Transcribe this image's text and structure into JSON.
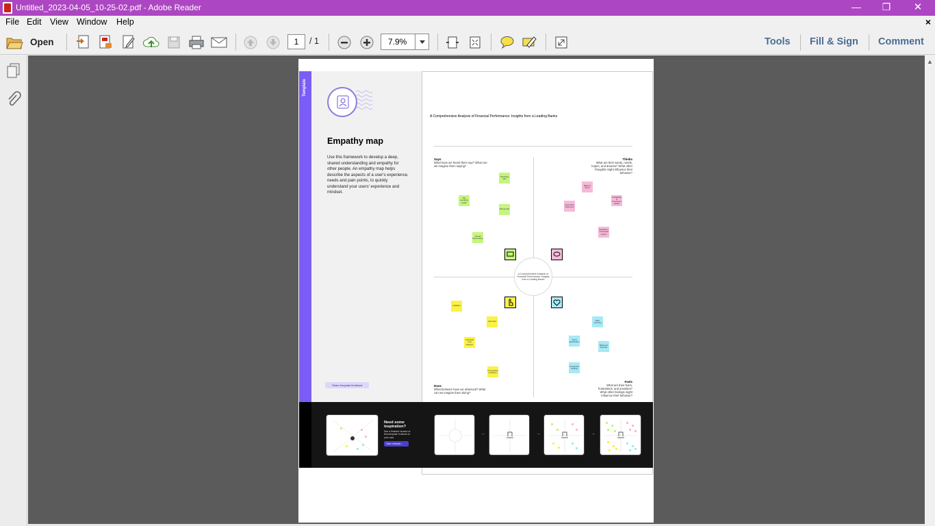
{
  "window": {
    "title": "Untitled_2023-04-05_10-25-02.pdf - Adobe Reader",
    "controls": {
      "minimize": "—",
      "restore": "❐",
      "close": "✕"
    }
  },
  "menu": {
    "items": [
      "File",
      "Edit",
      "View",
      "Window",
      "Help"
    ],
    "close": "×"
  },
  "toolbar": {
    "open_label": "Open",
    "page_current": "1",
    "page_total": "/ 1",
    "zoom": "7.9%",
    "tools": "Tools",
    "fill_sign": "Fill & Sign",
    "comment": "Comment"
  },
  "doc": {
    "side_label": "Template",
    "heading": "Empathy map",
    "description": "Use this framework to develop a deep, shared understanding and empathy for other people. An empathy map helps describe the aspects of a user's experience, needs and pain points, to quickly understand your users' experience and mindset.",
    "feedback": "Share template feedback",
    "board_title": "A Comprehensive Analysis of Financial Performance: Insights from a Leading Banks",
    "center_text": "A Comprehensive Analysis of Financial Performance: Insights from a Leading Banks",
    "quadrants": {
      "says": {
        "title": "Says",
        "lines": "What have we heard them say? What can we imagine them saying?"
      },
      "thinks": {
        "title": "Thinks",
        "lines": "What are their wants, needs, hopes, and dreams? What other thoughts might influence their behavior?"
      },
      "does": {
        "title": "Does",
        "lines": "What behavior have we observed? What can we imagine them doing?"
      },
      "feels": {
        "title": "Feels",
        "lines": "What are their fears, frustrations, and anxieties? What other feelings might influence their behavior?"
      }
    },
    "notes": {
      "green": [
        "Operating ratio",
        "Net operating profits",
        "ROI growth",
        "Overall Performance"
      ],
      "pink": [
        "Balance Sheet",
        "Profitability of Investment quality",
        "Cash Flow Statement",
        "Evaluation of financial metrics"
      ],
      "yellow": [
        "Liabilities",
        "Cash flow",
        "Financial Cost analysis",
        "Comparative evaluation"
      ],
      "blue": [
        "Ratio reporting",
        "Trend identification",
        "Balanced financial",
        "Transaction Auditing"
      ]
    },
    "inspiration": {
      "title": "Need some inspiration?",
      "text": "See a finished version of this template in Mural on your own.",
      "button": "Open example →"
    },
    "arrows": [
      "→",
      "→",
      "→"
    ]
  },
  "colors": {
    "titlebar": "#ad46c2",
    "accent_purple": "#7b5cf6",
    "toolbar_link": "#4a6c95",
    "doc_background": "#5b5b5b"
  }
}
